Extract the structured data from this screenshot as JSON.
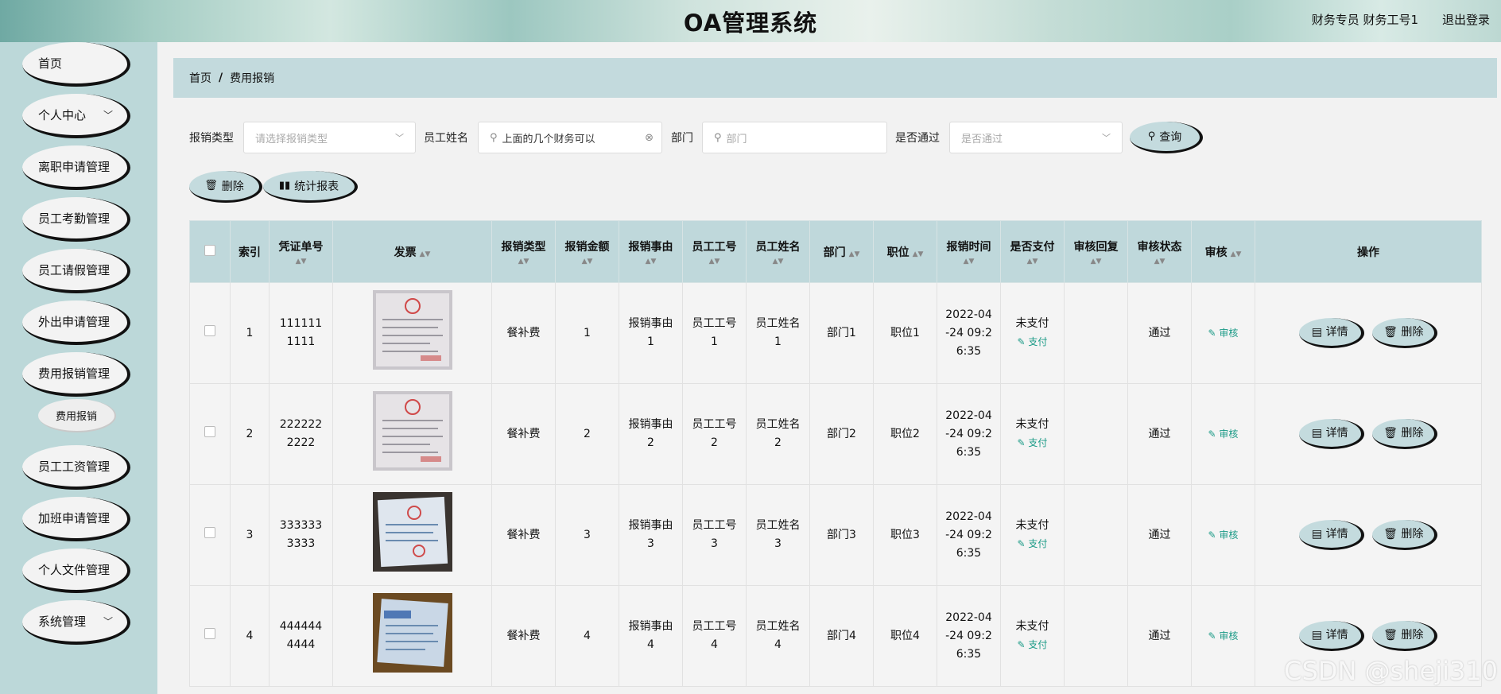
{
  "header": {
    "title": "OA管理系统",
    "user": "财务专员 财务工号1",
    "logout": "退出登录"
  },
  "sidebar": {
    "items": [
      {
        "label": "首页",
        "chev": ""
      },
      {
        "label": "个人中心",
        "chev": "﹀"
      },
      {
        "label": "离职申请管理",
        "chev": ""
      },
      {
        "label": "员工考勤管理",
        "chev": ""
      },
      {
        "label": "员工请假管理",
        "chev": ""
      },
      {
        "label": "外出申请管理",
        "chev": ""
      },
      {
        "label": "费用报销管理",
        "chev": ""
      },
      {
        "label": "员工工资管理",
        "chev": ""
      },
      {
        "label": "加班申请管理",
        "chev": ""
      },
      {
        "label": "个人文件管理",
        "chev": ""
      },
      {
        "label": "系统管理",
        "chev": "﹀"
      }
    ],
    "submenu": "费用报销"
  },
  "breadcrumb": {
    "home": "首页",
    "sep": "/",
    "current": "费用报销"
  },
  "filters": {
    "type_label": "报销类型",
    "type_placeholder": "请选择报销类型",
    "name_label": "员工姓名",
    "name_value": "上面的几个财务可以",
    "dept_label": "部门",
    "dept_placeholder": "部门",
    "pass_label": "是否通过",
    "pass_placeholder": "是否通过",
    "query": "查询"
  },
  "actions": {
    "delete": "删除",
    "report": "统计报表"
  },
  "table": {
    "headers": [
      "",
      "索引",
      "凭证单号",
      "发票",
      "报销类型",
      "报销金额",
      "报销事由",
      "员工工号",
      "员工姓名",
      "部门",
      "职位",
      "报销时间",
      "是否支付",
      "审核回复",
      "审核状态",
      "审核",
      "操作"
    ],
    "pay_action": "支付",
    "audit_action": "审核",
    "detail_btn": "详情",
    "delete_btn": "删除",
    "rows": [
      {
        "index": "1",
        "voucher": "1111111111",
        "type": "餐补费",
        "amount": "1",
        "reason": "报销事由1",
        "emp_no": "员工工号1",
        "emp_name": "员工姓名1",
        "dept": "部门1",
        "position": "职位1",
        "time": "2022-04-24 09:26:35",
        "paid": "未支付",
        "reply": "",
        "status": "通过"
      },
      {
        "index": "2",
        "voucher": "2222222222",
        "type": "餐补费",
        "amount": "2",
        "reason": "报销事由2",
        "emp_no": "员工工号2",
        "emp_name": "员工姓名2",
        "dept": "部门2",
        "position": "职位2",
        "time": "2022-04-24 09:26:35",
        "paid": "未支付",
        "reply": "",
        "status": "通过"
      },
      {
        "index": "3",
        "voucher": "3333333333",
        "type": "餐补费",
        "amount": "3",
        "reason": "报销事由3",
        "emp_no": "员工工号3",
        "emp_name": "员工姓名3",
        "dept": "部门3",
        "position": "职位3",
        "time": "2022-04-24 09:26:35",
        "paid": "未支付",
        "reply": "",
        "status": "通过"
      },
      {
        "index": "4",
        "voucher": "4444444444",
        "type": "餐补费",
        "amount": "4",
        "reason": "报销事由4",
        "emp_no": "员工工号4",
        "emp_name": "员工姓名4",
        "dept": "部门4",
        "position": "职位4",
        "time": "2022-04-24 09:26:35",
        "paid": "未支付",
        "reply": "",
        "status": "通过"
      }
    ]
  },
  "watermark": "CSDN @sheji310"
}
